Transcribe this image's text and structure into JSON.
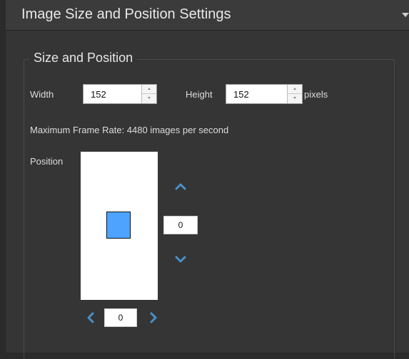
{
  "panel": {
    "title": "Image Size and Position Settings"
  },
  "size_position": {
    "legend": "Size and Position",
    "width_label": "Width",
    "width_value": "152",
    "height_label": "Height",
    "height_value": "152",
    "units_label": "pixels",
    "frame_rate_text": "Maximum Frame Rate: 4480 images per second",
    "position_label": "Position",
    "vertical_offset": "0",
    "horizontal_offset": "0"
  },
  "colors": {
    "panel_bg": "#353535",
    "header_bg": "#3b3b3b",
    "accent_arrow": "#4a90c8",
    "roi_fill": "#4da3ff"
  },
  "icons": {
    "collapse": "chevron-down-icon",
    "up": "chevron-up-icon",
    "down": "chevron-down-icon",
    "left": "chevron-left-icon",
    "right": "chevron-right-icon"
  }
}
